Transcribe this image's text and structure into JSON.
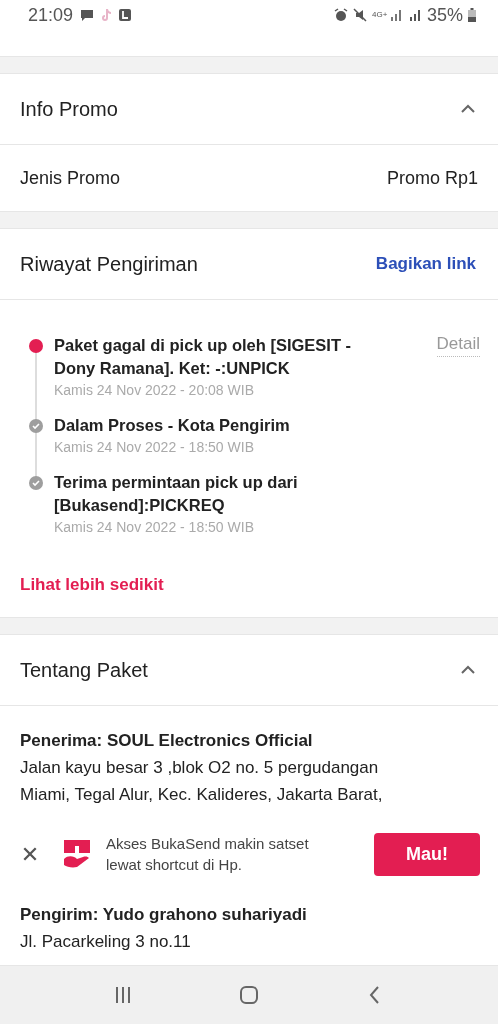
{
  "status_bar": {
    "time": "21:09",
    "network": "4G+",
    "battery": "35%"
  },
  "info_promo": {
    "title": "Info Promo",
    "expanded": true,
    "rows": [
      {
        "label": "Jenis Promo",
        "value": "Promo Rp1"
      }
    ]
  },
  "riwayat": {
    "title": "Riwayat Pengiriman",
    "action": "Bagikan link",
    "detail": "Detail",
    "more": "Lihat lebih sedikit",
    "events": [
      {
        "kind": "current",
        "title": "Paket gagal di pick up oleh [SIGESIT - Dony Ramana]. Ket: -:UNPICK",
        "time": "Kamis 24 Nov 2022 - 20:08 WIB"
      },
      {
        "kind": "done",
        "title": "Dalam Proses - Kota Pengirim",
        "time": "Kamis 24 Nov 2022 - 18:50 WIB"
      },
      {
        "kind": "done",
        "title": "Terima permintaan pick up dari [Bukasend]:PICKREQ",
        "time": "Kamis 24 Nov 2022 - 18:50 WIB"
      }
    ]
  },
  "tentang": {
    "title": "Tentang Paket",
    "expanded": true,
    "parties": [
      {
        "name": "Penerima: SOUL Electronics Official",
        "lines": [
          "Jalan kayu besar 3 ,blok O2 no. 5 pergudangan",
          "Miami, Tegal Alur, Kec. Kalideres, Jakarta Barat,"
        ]
      },
      {
        "name": "Pengirim: Yudo grahono suhariyadi",
        "lines": [
          "Jl. Pacarkeling 3 no.11"
        ]
      }
    ]
  },
  "banner": {
    "text": "Akses BukaSend makin satset lewat shortcut di Hp.",
    "button": "Mau!"
  }
}
